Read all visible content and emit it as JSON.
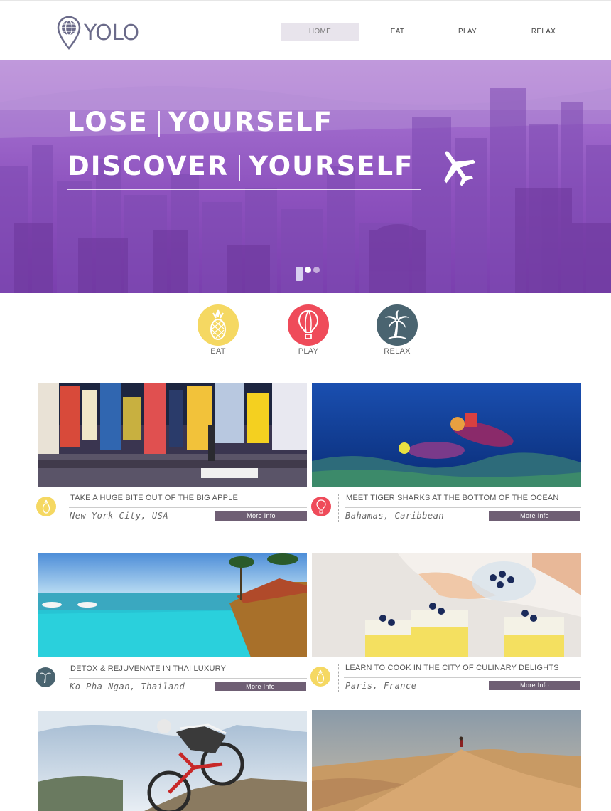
{
  "brand": {
    "name": "YOLO"
  },
  "nav": {
    "items": [
      {
        "label": "HOME",
        "active": true
      },
      {
        "label": "EAT",
        "active": false
      },
      {
        "label": "PLAY",
        "active": false
      },
      {
        "label": "RELAX",
        "active": false
      }
    ]
  },
  "hero": {
    "line1": [
      "LOSE",
      "YOURSELF"
    ],
    "line2": [
      "DISCOVER",
      "YOURSELF"
    ],
    "slides": 3,
    "active_slide": 1,
    "tint": "#9b5fc9"
  },
  "categories": [
    {
      "label": "EAT",
      "icon": "pineapple-icon",
      "color": "#f5d862"
    },
    {
      "label": "PLAY",
      "icon": "hot-air-balloon-icon",
      "color": "#ef4b5a"
    },
    {
      "label": "RELAX",
      "icon": "palm-tree-icon",
      "color": "#4a6470"
    }
  ],
  "cards": [
    {
      "title": "TAKE A HUGE BITE OUT OF THE BIG APPLE",
      "location": "New York City, USA",
      "button": "More Info",
      "category_icon": "pineapple-icon",
      "category_color": "#f5d862",
      "image": "times-square-photo"
    },
    {
      "title": "MEET TIGER SHARKS AT THE BOTTOM OF THE OCEAN",
      "location": "Bahamas, Caribbean",
      "button": "More Info",
      "category_icon": "hot-air-balloon-icon",
      "category_color": "#ef4b5a",
      "image": "scuba-divers-photo"
    },
    {
      "title": "DETOX & REJUVENATE IN THAI LUXURY",
      "location": "Ko Pha Ngan, Thailand",
      "button": "More Info",
      "category_icon": "palm-tree-icon",
      "category_color": "#4a6470",
      "image": "infinity-pool-photo"
    },
    {
      "title": "LEARN TO COOK IN THE CITY OF CULINARY DELIGHTS",
      "location": "Paris, France",
      "button": "More Info",
      "category_icon": "pineapple-icon",
      "category_color": "#f5d862",
      "image": "blueberry-dessert-photo"
    },
    {
      "image": "mountain-biker-photo"
    },
    {
      "image": "desert-dune-photo"
    }
  ],
  "colors": {
    "button": "#6f5f74",
    "nav_active_bg": "#e8e4ec",
    "logo": "#6b6b8a"
  }
}
